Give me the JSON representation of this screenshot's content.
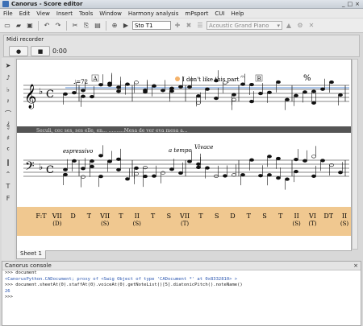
{
  "window": {
    "title": "Canorus - Score editor",
    "controls": [
      "_",
      "□",
      "×"
    ]
  },
  "menu": [
    "File",
    "Edit",
    "View",
    "Insert",
    "Tools",
    "Window",
    "Harmony analysis",
    "mPsport",
    "CUI",
    "Help"
  ],
  "toolbar": {
    "voice_name": "Sto T1",
    "instrument": "Acoustic Grand Piano"
  },
  "midi": {
    "title": "Midi recorder",
    "time": "0:00"
  },
  "score": {
    "tempo": "♩=72",
    "marks": [
      "A",
      "B"
    ],
    "comment": "I don't like this part",
    "lyrics": "Seculi, cec ses, ses elle, en... ..........Mesa de ver eva mesa a...",
    "dynamics": [
      "espressivo",
      "a tempo",
      "Vivace"
    ],
    "analysis": [
      {
        "func": "F:T",
        "sub": ""
      },
      {
        "func": "VII",
        "sub": "(D)"
      },
      {
        "func": "D",
        "sub": ""
      },
      {
        "func": "T",
        "sub": ""
      },
      {
        "func": "VII",
        "sub": "(S)"
      },
      {
        "func": "T",
        "sub": ""
      },
      {
        "func": "II",
        "sub": "(S)"
      },
      {
        "func": "T",
        "sub": ""
      },
      {
        "func": "S",
        "sub": ""
      },
      {
        "func": "VII",
        "sub": "(T)"
      },
      {
        "func": "T",
        "sub": ""
      },
      {
        "func": "S",
        "sub": ""
      },
      {
        "func": "D",
        "sub": ""
      },
      {
        "func": "T",
        "sub": ""
      },
      {
        "func": "S",
        "sub": ""
      },
      {
        "func": "T",
        "sub": ""
      },
      {
        "func": "II",
        "sub": "(S)"
      },
      {
        "func": "VI",
        "sub": "(T)"
      },
      {
        "func": "DT",
        "sub": ""
      },
      {
        "func": "II",
        "sub": "(S)"
      }
    ]
  },
  "sheet_tab": "Sheet 1",
  "console": {
    "title": "Canorus console",
    "lines": [
      {
        "text": ">>> document",
        "blue": false
      },
      {
        "text": "<CanorusPython.CADocument; proxy of <Swig Object of type 'CADocument *' at 0x8332810> >",
        "blue": true
      },
      {
        "text": ">>> document.sheetAt(0).staffAt(0).voiceAt(0).getNoteList()[5].diatonicPitch().noteName()",
        "blue": false
      },
      {
        "text": "26",
        "blue": true
      },
      {
        "text": ">>>",
        "blue": false
      }
    ]
  }
}
